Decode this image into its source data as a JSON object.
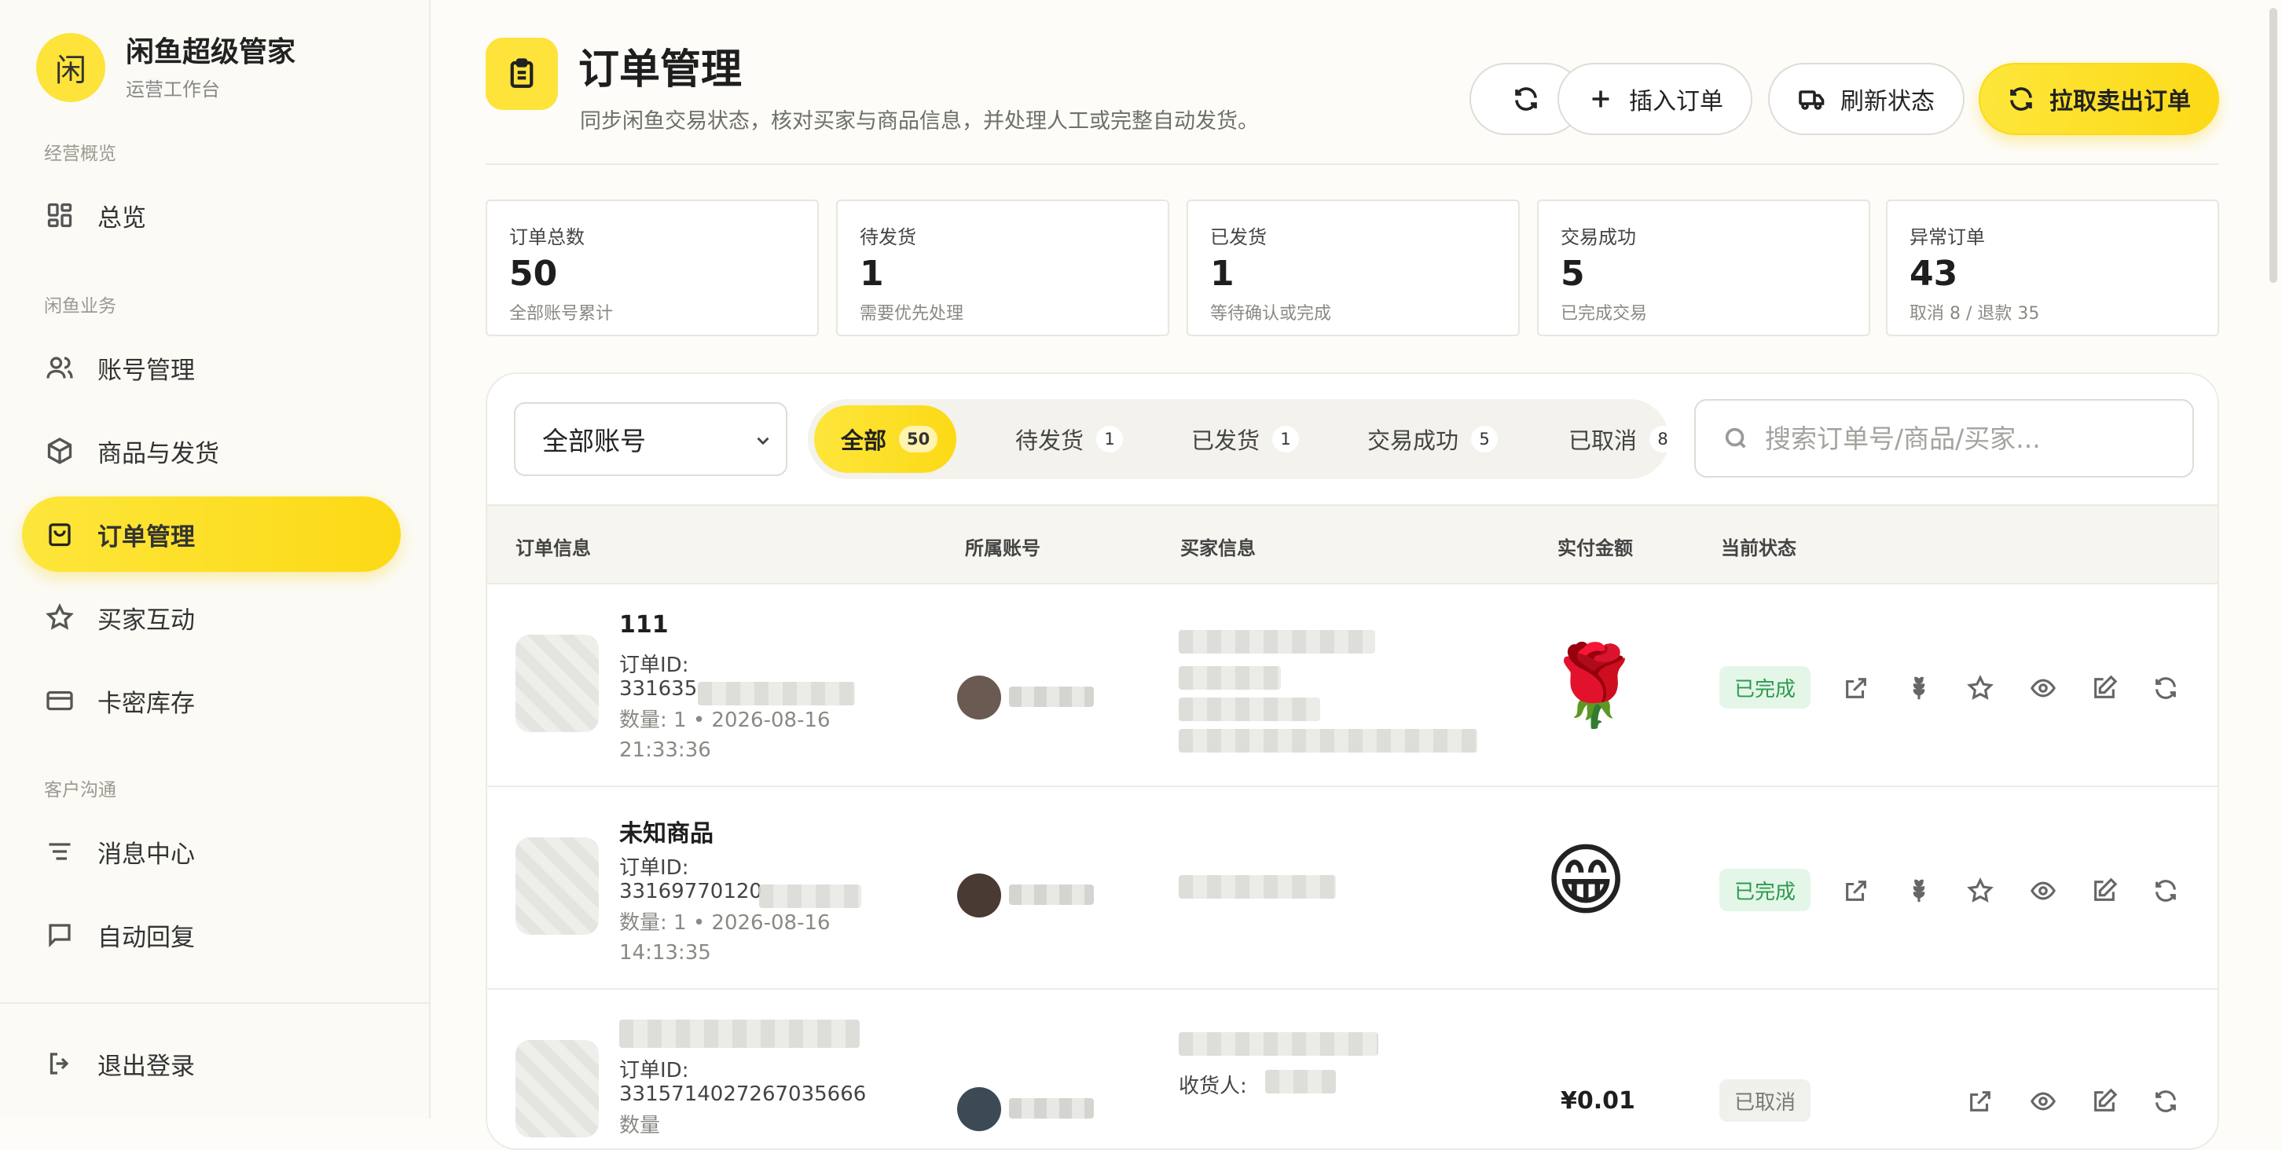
{
  "brand": {
    "logo_char": "闲",
    "title": "闲鱼超级管家",
    "subtitle": "运营工作台"
  },
  "sidebar": {
    "sections": [
      "经营概览",
      "闲鱼业务",
      "客户沟通"
    ],
    "items": [
      {
        "label": "总览",
        "icon": "grid-icon"
      },
      {
        "label": "账号管理",
        "icon": "users-icon"
      },
      {
        "label": "商品与发货",
        "icon": "box-icon"
      },
      {
        "label": "订单管理",
        "icon": "bag-icon",
        "active": true
      },
      {
        "label": "买家互动",
        "icon": "star-icon"
      },
      {
        "label": "卡密库存",
        "icon": "card-icon"
      },
      {
        "label": "消息中心",
        "icon": "filter-lines-icon"
      },
      {
        "label": "自动回复",
        "icon": "message-square-icon"
      }
    ],
    "logout": "退出登录"
  },
  "header": {
    "title": "订单管理",
    "subtitle": "同步闲鱼交易状态，核对买家与商品信息，并处理人工或完整自动发货。",
    "buttons": {
      "insert": "插入订单",
      "refresh_status": "刷新状态",
      "pull_orders": "拉取卖出订单"
    }
  },
  "stats": [
    {
      "label": "订单总数",
      "value": "50",
      "note": "全部账号累计"
    },
    {
      "label": "待发货",
      "value": "1",
      "note": "需要优先处理"
    },
    {
      "label": "已发货",
      "value": "1",
      "note": "等待确认或完成"
    },
    {
      "label": "交易成功",
      "value": "5",
      "note": "已完成交易"
    },
    {
      "label": "异常订单",
      "value": "43",
      "note": "取消 8 / 退款 35"
    }
  ],
  "filters": {
    "account_select": "全部账号",
    "tabs": [
      {
        "label": "全部",
        "count": "50",
        "active": true
      },
      {
        "label": "待发货",
        "count": "1"
      },
      {
        "label": "已发货",
        "count": "1"
      },
      {
        "label": "交易成功",
        "count": "5"
      },
      {
        "label": "已取消",
        "count": "8"
      }
    ],
    "search_placeholder": "搜索订单号/商品/买家..."
  },
  "table": {
    "columns": [
      "订单信息",
      "所属账号",
      "买家信息",
      "实付金额",
      "当前状态"
    ],
    "id_label": "订单ID:",
    "rows": [
      {
        "name": "111",
        "order_id": "331635",
        "meta": "数量: 1 • 2026-08-16 21:33:36",
        "buyer_line": "",
        "amount_emoji": "🌹",
        "amount": "",
        "status": "已完成",
        "status_type": "ok"
      },
      {
        "name": "未知商品",
        "order_id": "33169770120",
        "meta": "数量: 1 • 2026-08-16 14:13:35",
        "buyer_line": "",
        "amount_emoji": "😁",
        "amount": "",
        "status": "已完成",
        "status_type": "ok"
      },
      {
        "name": "",
        "order_id": "3315714027267035666",
        "meta": "数量",
        "buyer_line": "收货人:",
        "amount_emoji": "",
        "amount": "¥0.01",
        "status": "已取消",
        "status_type": "cancel"
      }
    ]
  },
  "colors": {
    "accent": "#fde33a",
    "success_bg": "#e3f6e8",
    "success_text": "#2e9a4e"
  }
}
